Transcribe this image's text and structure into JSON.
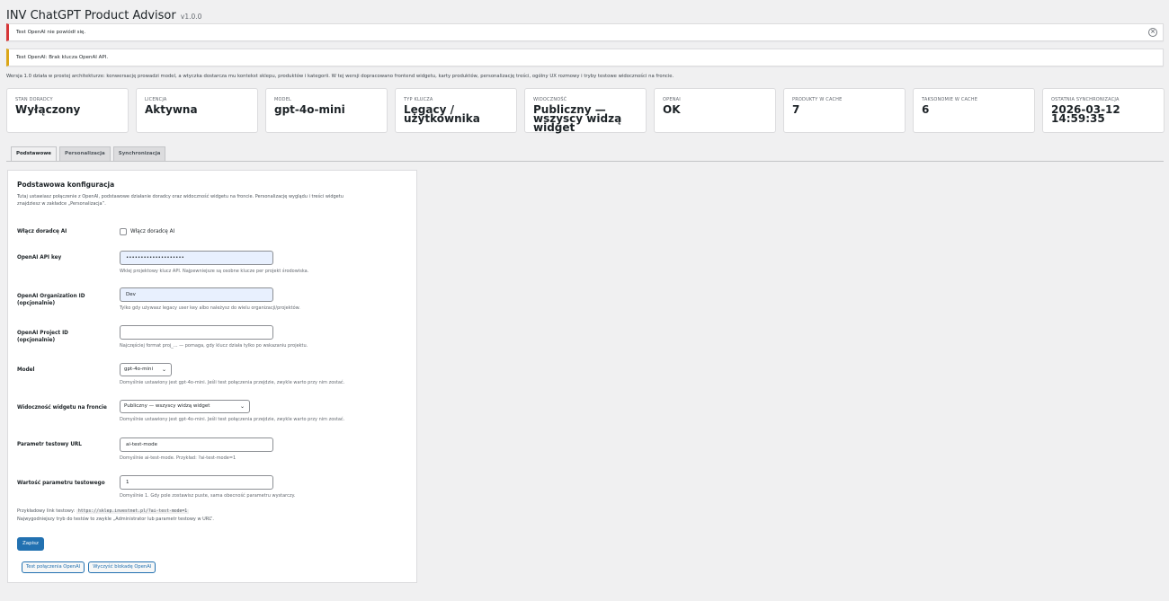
{
  "page": {
    "title": "INV ChatGPT Product Advisor",
    "version": "v1.0.0"
  },
  "notices": [
    {
      "text": "Test OpenAI nie powiódł się."
    },
    {
      "text": "Test OpenAI: Brak klucza OpenAI API."
    }
  ],
  "intro": "Wersja 1.0 działa w prostej architekturze: konwersację prowadzi model, a wtyczka dostarcza mu kontekst sklepu, produktów i kategorii. W tej wersji dopracowano frontend widgetu, karty produktów, personalizację treści, ogólny UX rozmowy i tryby testowe widoczności na froncie.",
  "stats": [
    {
      "label": "STAN DORADCY",
      "value": "Wyłączony"
    },
    {
      "label": "LICENCJA",
      "value": "Aktywna"
    },
    {
      "label": "MODEL",
      "value": "gpt-4o-mini"
    },
    {
      "label": "TYP KLUCZA",
      "value": "Legacy / użytkownika"
    },
    {
      "label": "WIDOCZNOŚĆ",
      "value": "Publiczny — wszyscy widzą widget"
    },
    {
      "label": "OPENAI",
      "value": "OK"
    },
    {
      "label": "PRODUKTY W CACHE",
      "value": "7"
    },
    {
      "label": "TAKSONOMIE W CACHE",
      "value": "6"
    },
    {
      "label": "OSTATNIA SYNCHRONIZACJA",
      "value": "2026-03-12 14:59:35"
    }
  ],
  "tabs": [
    "Podstawowe",
    "Personalizacja",
    "Synchronizacja"
  ],
  "panel": {
    "title": "Podstawowa konfiguracja",
    "description": "Tutaj ustawiasz połączenie z OpenAI, podstawowe działanie doradcy oraz widoczność widgetu na froncie. Personalizację wyglądu i treści widgetu znajdziesz w zakładce „Personalizacja”.",
    "fields": {
      "enable": {
        "label": "Włącz doradcę AI",
        "checkbox_label": "Włącz doradcę AI"
      },
      "api_key": {
        "label": "OpenAI API key",
        "value": "••••••••••••••••••••",
        "help": "Wklej projektowy klucz API. Najpewniejsze są osobne klucze per projekt środowiska."
      },
      "org_id": {
        "label_1": "OpenAI Organization ID",
        "label_2": "(opcjonalnie)",
        "value": "Dev",
        "help": "Tylko gdy używasz legacy user key albo należysz do wielu organizacji/projektów."
      },
      "project_id": {
        "label_1": "OpenAI Project ID",
        "label_2": "(opcjonalnie)",
        "value": "",
        "help": "Najczęściej format proj_... — pomaga, gdy klucz działa tylko po wskazaniu projektu."
      },
      "model": {
        "label": "Model",
        "value": "gpt-4o-mini",
        "help": "Domyślnie ustawiony jest gpt-4o-mini. Jeśli test połączenia przejdzie, zwykle warto przy nim zostać."
      },
      "visibility": {
        "label": "Widoczność widgetu na froncie",
        "value": "Publiczny — wszyscy widzą widget",
        "help": "Domyślnie ustawiony jest gpt-4o-mini. Jeśli test połączenia przejdzie, zwykle warto przy nim zostać."
      },
      "test_param": {
        "label": "Parametr testowy URL",
        "value": "ai-test-mode",
        "help": "Domyślnie ai-test-mode. Przykład: ?ai-test-mode=1"
      },
      "test_value": {
        "label": "Wartość parametru testowego",
        "value": "1",
        "help": "Domyślnie 1. Gdy pole zostawisz puste, sama obecność parametru wystarczy."
      }
    },
    "example_label": "Przykładowy link testowy:",
    "example_url": "https://sklep.investnet.pl/?ai-test-mode=1",
    "example_note": "Najwygodniejszy tryb do testów to zwykle „Administrator lub parametr testowy w URL”.",
    "save": "Zapisz",
    "test_button": "Test połączenia OpenAI",
    "clear_button": "Wyczyść blokadę OpenAI"
  }
}
